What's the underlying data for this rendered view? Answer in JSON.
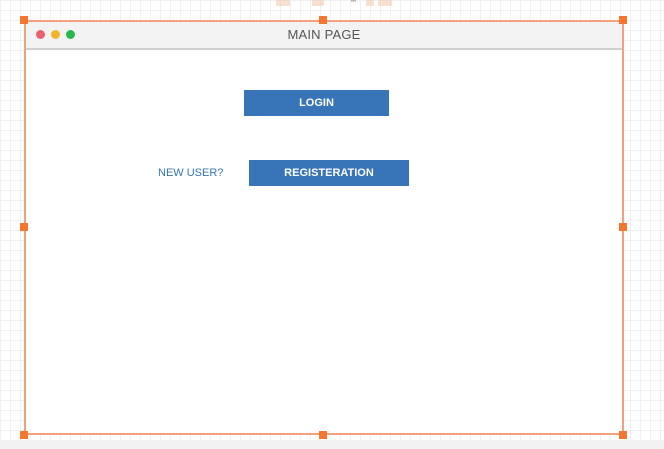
{
  "window": {
    "title": "MAIN PAGE",
    "controls": [
      "close",
      "minimize",
      "maximize"
    ]
  },
  "main": {
    "login_label": "LOGIN",
    "new_user_label": "NEW USER?",
    "register_label": "REGISTERATION"
  },
  "colors": {
    "button": "#3774b8",
    "link_text": "#3774b8",
    "selection": "#f5762e",
    "close": "#ec5f6e",
    "minimize": "#f2b52d",
    "maximize": "#29b84a"
  },
  "icons": [
    "gear-icon"
  ]
}
